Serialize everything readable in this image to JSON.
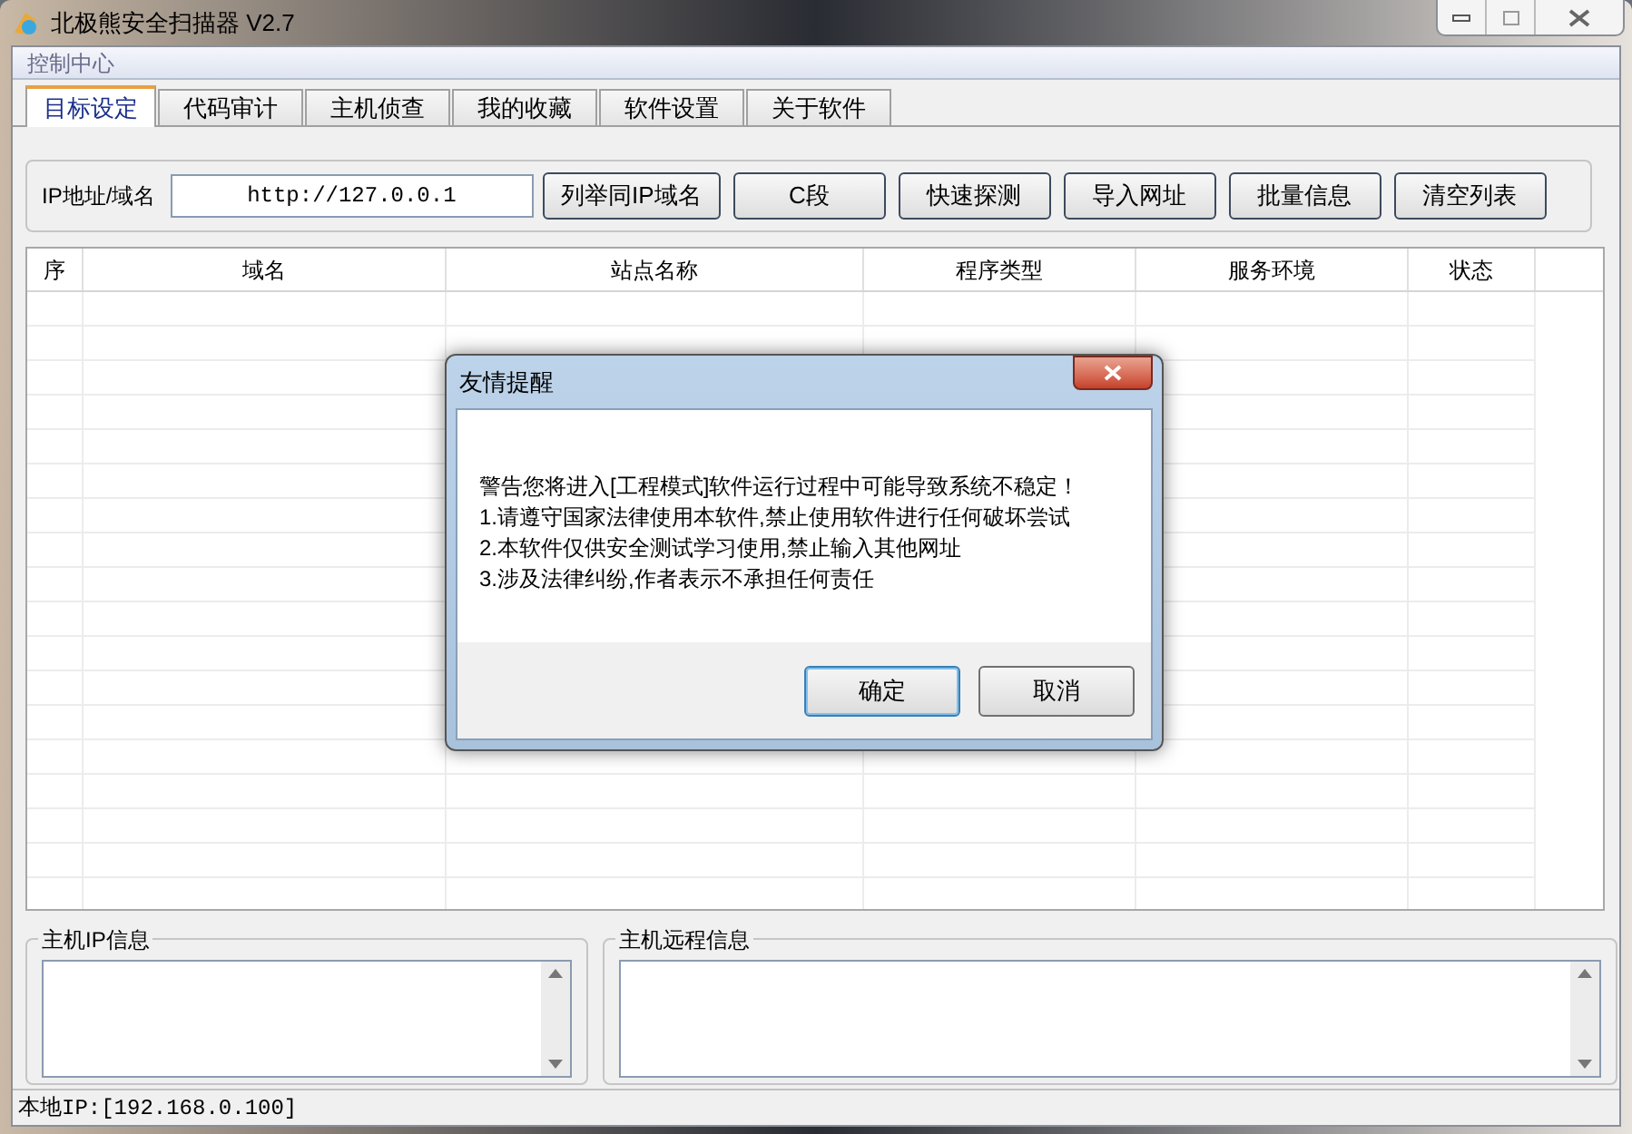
{
  "window": {
    "title": "北极熊安全扫描器 V2.7"
  },
  "menu": [
    "控制中心"
  ],
  "tabs": [
    {
      "label": "目标设定",
      "selected": true
    },
    {
      "label": "代码审计",
      "selected": false
    },
    {
      "label": "主机侦查",
      "selected": false
    },
    {
      "label": "我的收藏",
      "selected": false
    },
    {
      "label": "软件设置",
      "selected": false
    },
    {
      "label": "关于软件",
      "selected": false
    }
  ],
  "target": {
    "label": "IP地址/域名",
    "value": "http://127.0.0.1",
    "buttons": [
      "列举同IP域名",
      "C段",
      "快速探测",
      "导入网址",
      "批量信息",
      "清空列表"
    ]
  },
  "table": {
    "columns": [
      "序",
      "域名",
      "站点名称",
      "程序类型",
      "服务环境",
      "状态"
    ]
  },
  "panels": [
    {
      "title": "主机IP信息"
    },
    {
      "title": "主机远程信息"
    }
  ],
  "status_bar": "本地IP:[192.168.0.100]",
  "dialog": {
    "title": "友情提醒",
    "lines": [
      "警告您将进入[工程模式]软件运行过程中可能导致系统不稳定！",
      "1.请遵守国家法律使用本软件,禁止使用软件进行任何破坏尝试",
      "2.本软件仅供安全测试学习使用,禁止输入其他网址",
      "3.涉及法律纠纷,作者表示不承担任何责任"
    ],
    "buttons": [
      {
        "label": "确定",
        "selected": true
      },
      {
        "label": "取消",
        "selected": false
      }
    ]
  }
}
